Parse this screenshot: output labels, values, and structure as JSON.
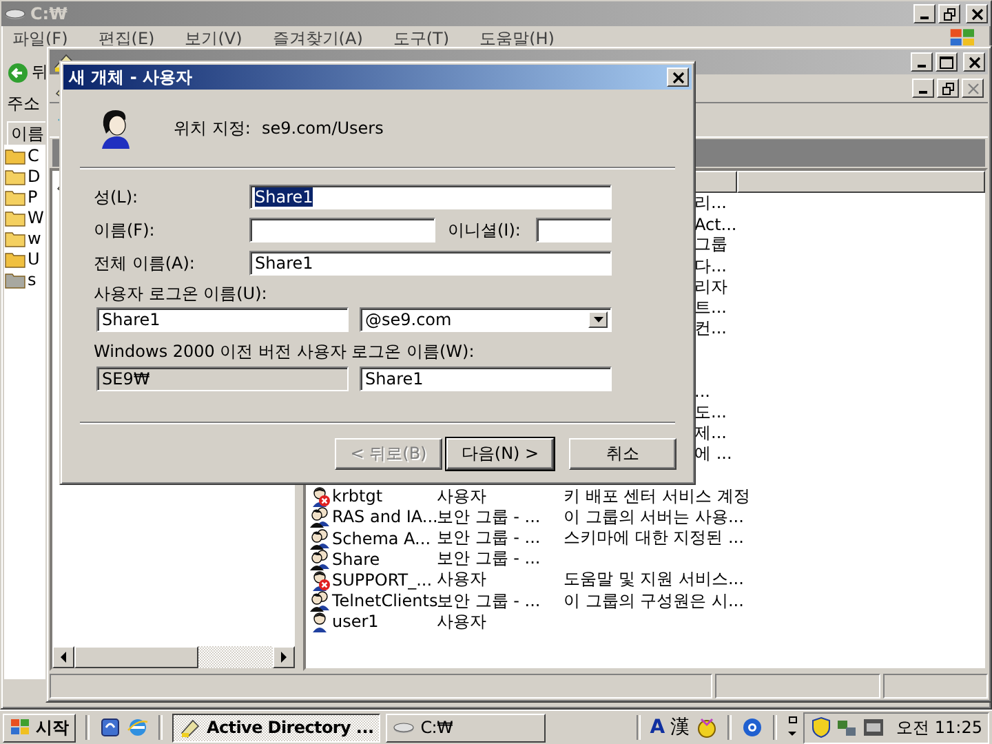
{
  "explorer": {
    "title": "C:₩",
    "menu": [
      "파일(F)",
      "편집(E)",
      "보기(V)",
      "즐겨찾기(A)",
      "도구(T)",
      "도움말(H)"
    ],
    "back_label": "뒤",
    "address_label": "주소",
    "column": "이름",
    "folders": [
      {
        "label": "C",
        "kind": "open"
      },
      {
        "label": "D",
        "kind": "folder"
      },
      {
        "label": "P",
        "kind": "folder"
      },
      {
        "label": "W",
        "kind": "folder"
      },
      {
        "label": "w",
        "kind": "folder"
      },
      {
        "label": "U",
        "kind": "open"
      },
      {
        "label": "s",
        "kind": "shared"
      }
    ]
  },
  "aduc": {
    "rows": [
      {
        "kind": "covered",
        "visible_text": "리..."
      },
      {
        "kind": "covered",
        "visible_text": "Act..."
      },
      {
        "kind": "covered",
        "visible_text": "그룹"
      },
      {
        "kind": "covered",
        "visible_text": "다..."
      },
      {
        "kind": "covered",
        "visible_text": "리자"
      },
      {
        "kind": "covered",
        "visible_text": "트..."
      },
      {
        "kind": "covered",
        "visible_text": "컨..."
      },
      {
        "kind": "covered"
      },
      {
        "kind": "covered"
      },
      {
        "kind": "covered",
        "visible_text": "..."
      },
      {
        "kind": "covered",
        "visible_text": "도..."
      },
      {
        "kind": "covered",
        "visible_text": "제..."
      },
      {
        "kind": "covered",
        "visible_text": "에 ..."
      },
      {
        "kind": "covered"
      },
      {
        "kind": "disabled_user",
        "name": "krbtgt",
        "type": "사용자",
        "description": "키 배포 센터 서비스 계정"
      },
      {
        "kind": "group",
        "name": "RAS and IA...",
        "type": "보안 그룹 - ...",
        "description": "이 그룹의 서버는 사용..."
      },
      {
        "kind": "group",
        "name": "Schema A...",
        "type": "보안 그룹 - ...",
        "description": "스키마에 대한 지정된 ..."
      },
      {
        "kind": "group",
        "name": "Share",
        "type": "보안 그룹 - ..."
      },
      {
        "kind": "disabled_user",
        "name": "SUPPORT_...",
        "type": "사용자",
        "description": "도움말 및 지원 서비스..."
      },
      {
        "kind": "group",
        "name": "TelnetClients",
        "type": "보안 그룹 - ...",
        "description": "이 그룹의 구성원은 시..."
      },
      {
        "kind": "user",
        "name": "user1",
        "type": "사용자"
      }
    ]
  },
  "dialog": {
    "title": "새 개체 - 사용자",
    "location_label": "위치 지정:",
    "location": "se9.com/Users",
    "last_name": {
      "label": "성(L):",
      "value": "Share1",
      "value_selected": true
    },
    "first_name": {
      "label": "이름(F):"
    },
    "initials": {
      "label": "이니셜(I):"
    },
    "full_name": {
      "label": "전체 이름(A):",
      "value": "Share1"
    },
    "logon_name": {
      "label": "사용자 로그온 이름(U):",
      "value": "Share1",
      "domain": "@se9.com"
    },
    "pre2000": {
      "label": "Windows 2000 이전 버전 사용자 로그온 이름(W):",
      "domain": "SE9₩",
      "domain_disabled": true,
      "value": "Share1"
    },
    "buttons": [
      {
        "label": "< 뒤로(B)",
        "disabled": true,
        "default": false
      },
      {
        "label": "다음(N) >",
        "disabled": false,
        "default": true
      },
      {
        "label": "취소",
        "disabled": false,
        "default": false
      }
    ]
  },
  "taskbar": {
    "start": "시작",
    "tasks": [
      {
        "label": "Active Directory ...",
        "selected": true
      },
      {
        "label": "C:₩",
        "selected": false
      }
    ],
    "input_mode": "A",
    "hanja": "漢",
    "clock": "오전 11:25"
  }
}
